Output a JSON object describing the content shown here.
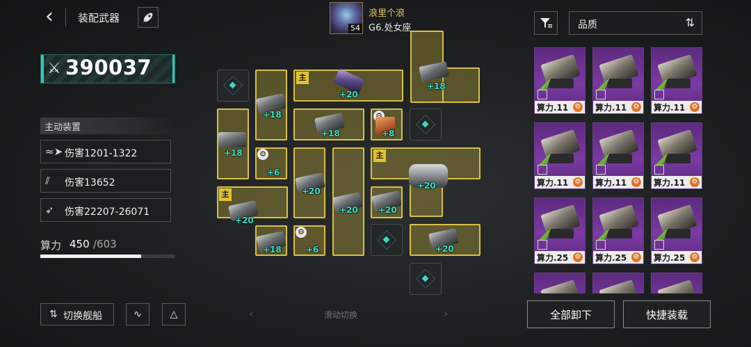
{
  "header": {
    "back_icon": "chevron-left-icon",
    "title": "装配武器",
    "rocket_icon": "rocket-icon"
  },
  "player": {
    "name": "浪里个浪",
    "level": "54",
    "guild": "G6.处女座"
  },
  "ship_power": {
    "icon": "crossed-swords-icon",
    "value": "390037"
  },
  "active_equipment": {
    "label": "主动装置",
    "items": [
      {
        "icon": "missile-swarm-icon",
        "text": "伤害1201-1322"
      },
      {
        "icon": "beam-icon",
        "text": "伤害13652"
      },
      {
        "icon": "torpedo-icon",
        "text": "伤害22207-26071"
      }
    ]
  },
  "compute": {
    "label": "算力",
    "current": "450",
    "max": "/603",
    "fraction": 0.746
  },
  "bottom_left": {
    "switch_label": "切换舰船",
    "switch_icon": "swap-icon",
    "wave_icon": "waveform-icon",
    "fleet_icon": "fleet-icon"
  },
  "grid": {
    "main_marker": "主",
    "bonuses": [
      "+18",
      "+20",
      "+18",
      "+18",
      "+8",
      "+18",
      "+6",
      "+20",
      "+20",
      "+20",
      "+20",
      "+20",
      "+18",
      "+6",
      "+20"
    ]
  },
  "swipe_hint": "滑动切换",
  "inventory": {
    "sort_label": "品质",
    "filter_icon": "filter-icon",
    "sort_icon": "sort-toggle-icon",
    "cards": [
      {
        "label": "算力.11"
      },
      {
        "label": "算力.11"
      },
      {
        "label": "算力.11"
      },
      {
        "label": "算力.11"
      },
      {
        "label": "算力.11"
      },
      {
        "label": "算力.11"
      },
      {
        "label": "算力.25"
      },
      {
        "label": "算力.25"
      },
      {
        "label": "算力.25"
      }
    ]
  },
  "actions": {
    "unload_all": "全部卸下",
    "quick_load": "快捷装载"
  },
  "colors": {
    "accent_teal": "#38e0c8",
    "slot_yellow": "#d9c04a",
    "card_purple": "#7a3aa3",
    "name_gold": "#e3c36a"
  }
}
